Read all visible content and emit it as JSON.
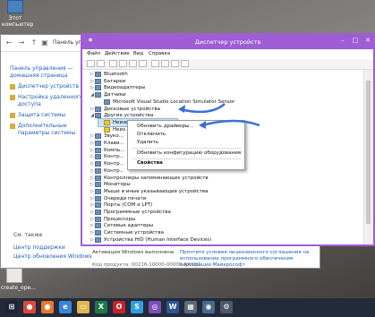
{
  "desktop": {
    "icons": [
      {
        "label": "Этот компьютер",
        "kind": "pc"
      },
      {
        "label": "create_ope...",
        "kind": "file"
      }
    ]
  },
  "system_window": {
    "breadcrumb": "Панель управления → ...",
    "left_links": [
      "Панель управления — домашняя страница",
      "Диспетчер устройств",
      "Настройка удаленного доступа",
      "Защита системы",
      "Дополнительные параметры системы"
    ],
    "see_also": "См. также",
    "see_also_links": [
      "Центр поддержки",
      "Центр обновления Windows"
    ],
    "activation_label": "Активация Windows выполнена",
    "activation_text": "Прочтите условия лицензионного соглашения на использование программного обеспечения корпорации Майкрософт",
    "product_code": "Код продукта: 00216-10000-00000-AA000"
  },
  "device_manager": {
    "title": "Диспетчер устройств",
    "menu": [
      "Файл",
      "Действие",
      "Вид",
      "Справка"
    ],
    "tree": [
      {
        "label": "Bluetooth",
        "indent": 1,
        "expander": "▷"
      },
      {
        "label": "Батареи",
        "indent": 1,
        "expander": "▷"
      },
      {
        "label": "Видеоадаптеры",
        "indent": 1,
        "expander": "▷"
      },
      {
        "label": "Датчики",
        "indent": 1,
        "expander": "◢"
      },
      {
        "label": "Microsoft Visual Studio Location Simulator Sensor",
        "indent": 2,
        "expander": ""
      },
      {
        "label": "Дисковые устройства",
        "indent": 1,
        "expander": "▷"
      },
      {
        "label": "Другие устройства",
        "indent": 1,
        "expander": "◢"
      },
      {
        "label": "Неизвестное устройство",
        "indent": 2,
        "expander": "",
        "warn": true,
        "selected": true
      },
      {
        "label": "Неиз...",
        "indent": 2,
        "expander": "",
        "warn": true
      },
      {
        "label": "Звуко...",
        "indent": 1,
        "expander": "▷"
      },
      {
        "label": "Клави...",
        "indent": 1,
        "expander": "▷"
      },
      {
        "label": "Компь...",
        "indent": 1,
        "expander": "▷"
      },
      {
        "label": "Контр...",
        "indent": 1,
        "expander": "▷"
      },
      {
        "label": "Контр...",
        "indent": 1,
        "expander": "▷"
      },
      {
        "label": "Контр...",
        "indent": 1,
        "expander": "▷"
      },
      {
        "label": "Контроллеры запоминающих устройств",
        "indent": 1,
        "expander": "▷"
      },
      {
        "label": "Мониторы",
        "indent": 1,
        "expander": "▷"
      },
      {
        "label": "Мыши и иные указывающие устройства",
        "indent": 1,
        "expander": "▷"
      },
      {
        "label": "Очереди печати",
        "indent": 1,
        "expander": "▷"
      },
      {
        "label": "Порты (COM и LPT)",
        "indent": 1,
        "expander": "▷"
      },
      {
        "label": "Программные устройства",
        "indent": 1,
        "expander": "▷"
      },
      {
        "label": "Процессоры",
        "indent": 1,
        "expander": "▷"
      },
      {
        "label": "Сетевые адаптеры",
        "indent": 1,
        "expander": "▷"
      },
      {
        "label": "Системные устройства",
        "indent": 1,
        "expander": "▷"
      },
      {
        "label": "Устройства HID (Human Interface Devices)",
        "indent": 1,
        "expander": "▷"
      }
    ],
    "context_menu": [
      "Обновить драйверы...",
      "Отключить",
      "Удалить",
      "Обновить конфигурацию оборудования",
      "Свойства"
    ]
  },
  "taskbar": {
    "items": [
      {
        "name": "start-button",
        "glyph": "⊞",
        "color": "#1e2433"
      },
      {
        "name": "chrome-icon",
        "glyph": "●",
        "color": "#d94a38"
      },
      {
        "name": "firefox-icon",
        "glyph": "●",
        "color": "#e8762d"
      },
      {
        "name": "ie-icon",
        "glyph": "e",
        "color": "#3a86d8"
      },
      {
        "name": "explorer-icon",
        "glyph": "▭",
        "color": "#e2b64a"
      },
      {
        "name": "excel-icon",
        "glyph": "X",
        "color": "#1f7a45"
      },
      {
        "name": "opera-icon",
        "glyph": "O",
        "color": "#c4232a"
      },
      {
        "name": "skype-icon",
        "glyph": "S",
        "color": "#2f9ee0"
      },
      {
        "name": "viber-icon",
        "glyph": "◎",
        "color": "#7b4fb8"
      },
      {
        "name": "word-icon",
        "glyph": "W",
        "color": "#2b5797"
      },
      {
        "name": "paint-icon",
        "glyph": "▦",
        "color": "#5a6a7a"
      },
      {
        "name": "network-icon",
        "glyph": "◉",
        "color": "#4a6a8a"
      },
      {
        "name": "settings-icon",
        "glyph": "⚙",
        "color": "#4a5a6a"
      }
    ]
  },
  "colors": {
    "accent": "#a05ed6",
    "arrow": "#3c70d8",
    "selection": "#cde3f7"
  }
}
